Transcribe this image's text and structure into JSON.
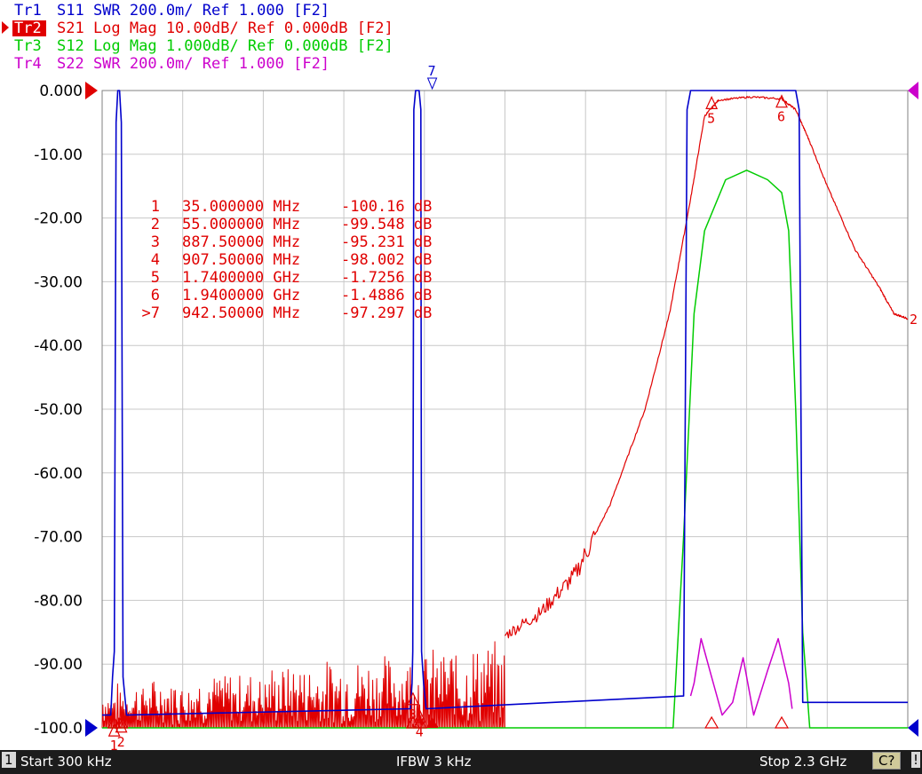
{
  "trace_headers": [
    {
      "id": "Tr1",
      "text": "S11  SWR 200.0m/ Ref 1.000 [F2]",
      "color": "#0000cc",
      "active": false
    },
    {
      "id": "Tr2",
      "text": "S21  Log Mag 10.00dB/ Ref 0.000dB [F2]",
      "color": "#e00000",
      "active": true
    },
    {
      "id": "Tr3",
      "text": "S12  Log Mag 1.000dB/ Ref 0.000dB [F2]",
      "color": "#00cc00",
      "active": false
    },
    {
      "id": "Tr4",
      "text": "S22  SWR 200.0m/ Ref 1.000 [F2]",
      "color": "#cc00cc",
      "active": false
    }
  ],
  "marker_table": [
    {
      "n": "1",
      "freq": "35.000000 MHz",
      "val": "-100.16 dB"
    },
    {
      "n": "2",
      "freq": "55.000000 MHz",
      "val": "-99.548 dB"
    },
    {
      "n": "3",
      "freq": "887.50000 MHz",
      "val": "-95.231 dB"
    },
    {
      "n": "4",
      "freq": "907.50000 MHz",
      "val": "-98.002 dB"
    },
    {
      "n": "5",
      "freq": "1.7400000 GHz",
      "val": "-1.7256 dB"
    },
    {
      "n": "6",
      "freq": "1.9400000 GHz",
      "val": "-1.4886 dB"
    },
    {
      "n": ">7",
      "freq": "942.50000 MHz",
      "val": "-97.297 dB"
    }
  ],
  "status": {
    "channel": "1",
    "start": "Start 300 kHz",
    "ifbw": "IFBW 3 kHz",
    "stop": "Stop 2.3 GHz",
    "cal": "C?",
    "warn": "!"
  },
  "chart_data": {
    "type": "line",
    "xlim": [
      0.0003,
      2.3
    ],
    "x_unit": "GHz",
    "ylim": [
      -100,
      0
    ],
    "y_ticks": [
      "0.000",
      "-10.00",
      "-20.00",
      "-30.00",
      "-40.00",
      "-50.00",
      "-60.00",
      "-70.00",
      "-80.00",
      "-90.00",
      "-100.0"
    ],
    "y_tick_values": [
      0,
      -10,
      -20,
      -30,
      -40,
      -50,
      -60,
      -70,
      -80,
      -90,
      -100
    ],
    "grid": true,
    "colors": {
      "tr1": "#0000cc",
      "tr2": "#e00000",
      "tr3": "#00cc00",
      "tr4": "#cc00cc",
      "grid": "#c8c8c8"
    },
    "series": [
      {
        "key": "tr2",
        "color": "#e00000",
        "end_label": "2",
        "noise_floor": {
          "x_range": [
            0.0003,
            1.15
          ],
          "min": -100,
          "max": -86
        },
        "points": [
          [
            1.15,
            -85.5
          ],
          [
            1.25,
            -82
          ],
          [
            1.35,
            -76
          ],
          [
            1.45,
            -65
          ],
          [
            1.55,
            -50
          ],
          [
            1.62,
            -35
          ],
          [
            1.68,
            -17
          ],
          [
            1.72,
            -4
          ],
          [
            1.76,
            -1.5
          ],
          [
            1.85,
            -1.0
          ],
          [
            1.94,
            -1.3
          ],
          [
            1.98,
            -3
          ],
          [
            2.02,
            -8
          ],
          [
            2.07,
            -15
          ],
          [
            2.15,
            -25
          ],
          [
            2.22,
            -31
          ],
          [
            2.26,
            -35
          ],
          [
            2.3,
            -35.8
          ]
        ]
      },
      {
        "key": "tr3",
        "color": "#00cc00",
        "points": [
          [
            0.0003,
            -100
          ],
          [
            1.58,
            -100
          ],
          [
            1.63,
            -100
          ],
          [
            1.66,
            -70
          ],
          [
            1.69,
            -35
          ],
          [
            1.72,
            -22
          ],
          [
            1.78,
            -14
          ],
          [
            1.84,
            -12.5
          ],
          [
            1.9,
            -14
          ],
          [
            1.94,
            -16
          ],
          [
            1.96,
            -22
          ],
          [
            1.98,
            -50
          ],
          [
            2.0,
            -85
          ],
          [
            2.02,
            -100
          ],
          [
            2.3,
            -100
          ]
        ]
      },
      {
        "key": "tr1",
        "color": "#0000cc",
        "points": [
          [
            0.0003,
            -98
          ],
          [
            0.025,
            -98
          ],
          [
            0.03,
            -92
          ],
          [
            0.035,
            -88
          ],
          [
            0.04,
            -5
          ],
          [
            0.045,
            0
          ],
          [
            0.05,
            0
          ],
          [
            0.055,
            -5
          ],
          [
            0.06,
            -92
          ],
          [
            0.07,
            -98
          ],
          [
            0.88,
            -97
          ],
          [
            0.885,
            -93
          ],
          [
            0.887,
            -88
          ],
          [
            0.89,
            -3
          ],
          [
            0.895,
            0
          ],
          [
            0.905,
            0
          ],
          [
            0.91,
            -3
          ],
          [
            0.912,
            -88
          ],
          [
            0.918,
            -93
          ],
          [
            0.925,
            -97
          ],
          [
            1.66,
            -95
          ],
          [
            1.67,
            -3
          ],
          [
            1.68,
            0
          ],
          [
            1.98,
            0
          ],
          [
            1.99,
            -3
          ],
          [
            2.0,
            -96
          ],
          [
            2.3,
            -96
          ]
        ]
      },
      {
        "key": "tr4",
        "color": "#cc00cc",
        "points": [
          [
            1.68,
            -95
          ],
          [
            1.69,
            -93
          ],
          [
            1.71,
            -86
          ],
          [
            1.74,
            -92
          ],
          [
            1.77,
            -98
          ],
          [
            1.8,
            -96
          ],
          [
            1.83,
            -89
          ],
          [
            1.86,
            -98
          ],
          [
            1.9,
            -91
          ],
          [
            1.93,
            -86
          ],
          [
            1.96,
            -93
          ],
          [
            1.97,
            -97
          ]
        ]
      }
    ],
    "markers": [
      {
        "n": "1",
        "x": 0.035,
        "y": -100.16
      },
      {
        "n": "2",
        "x": 0.055,
        "y": -99.548
      },
      {
        "n": "3",
        "x": 0.8875,
        "y": -95.231
      },
      {
        "n": "4",
        "x": 0.9075,
        "y": -98.002
      },
      {
        "n": "5",
        "x": 1.74,
        "y": -1.7256
      },
      {
        "n": "6",
        "x": 1.94,
        "y": -1.4886
      },
      {
        "n": "7",
        "x": 0.9425,
        "y": -97.297
      }
    ]
  }
}
